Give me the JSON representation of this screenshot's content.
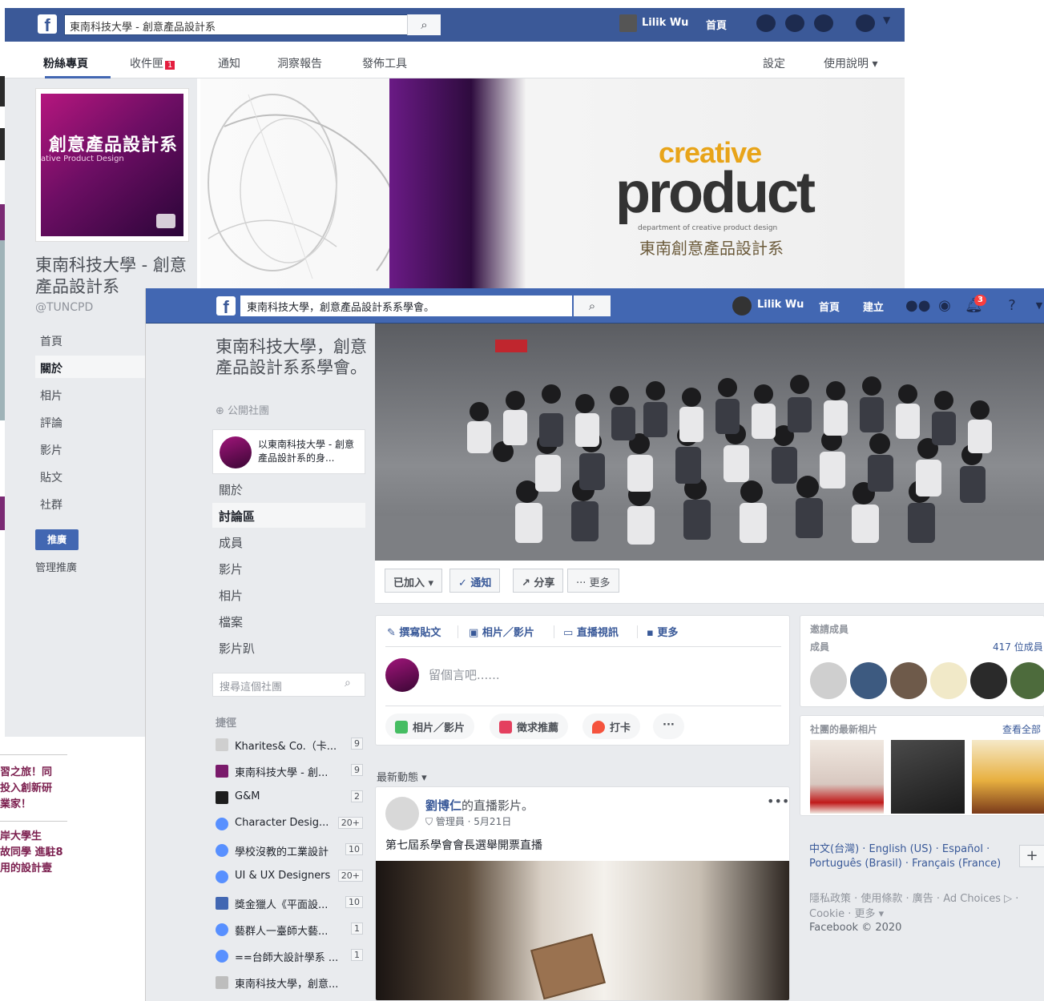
{
  "colors": {
    "fb_blue": "#4267b2",
    "fb_blue_dark": "#3b5998",
    "link": "#385898",
    "badge_red": "#fa3e3e",
    "page_purple": "#6d0e64"
  },
  "background_window": {
    "search_value": "東南科技大學 - 創意產品設計系",
    "user_name": "Lilik Wu",
    "home_label": "首頁",
    "tabs": [
      {
        "label": "粉絲專頁",
        "active": true
      },
      {
        "label": "收件匣",
        "badge": "1"
      },
      {
        "label": "通知"
      },
      {
        "label": "洞察報告"
      },
      {
        "label": "發佈工具"
      }
    ],
    "settings_label": "設定",
    "help_label": "使用說明 ▾",
    "page_pic_title": "創意產品設計系",
    "page_pic_subtitle": "ative Product Design",
    "page_name": "東南科技大學 - 創意產品設計系",
    "page_handle": "@TUNCPD",
    "nav": [
      {
        "label": "首頁"
      },
      {
        "label": "關於",
        "active": true
      },
      {
        "label": "相片"
      },
      {
        "label": "評論"
      },
      {
        "label": "影片"
      },
      {
        "label": "貼文"
      },
      {
        "label": "社群"
      }
    ],
    "promote_label": "推廣",
    "manage_promotions_label": "管理推廣",
    "cover_creative": "creative",
    "cover_product": "product",
    "cover_department": "department of creative product design",
    "cover_chinese": "東南創意產品設計系",
    "left_notes": [
      "習之旅！同\n投入創新研\n業家！",
      "岸大學生\n故同學 進駐8\n用的設計壹"
    ]
  },
  "foreground_window": {
    "search_value": "東南科技大學，創意產品設計系系學會。",
    "user_name": "Lilik Wu",
    "top_nav": [
      "首頁",
      "建立"
    ],
    "notification_count": "3",
    "group_name": "東南科技大學，創意產品設計系系學會。",
    "group_type": "公開社團",
    "shortcut_box_text": "以東南科技大學 - 創意產品設計系的身...",
    "left_nav": [
      {
        "label": "關於"
      },
      {
        "label": "討論區",
        "active": true
      },
      {
        "label": "成員"
      },
      {
        "label": "影片"
      },
      {
        "label": "相片"
      },
      {
        "label": "檔案"
      },
      {
        "label": "影片趴"
      }
    ],
    "group_search_placeholder": "搜尋這個社團",
    "shortcuts_heading": "捷徑",
    "shortcuts": [
      {
        "name": "Kharites& Co.（卡...",
        "count": "9",
        "icon_color": "#cfcfcf"
      },
      {
        "name": "東南科技大學 - 創...",
        "count": "9",
        "icon_color": "#7a1a6b"
      },
      {
        "name": "G&M",
        "count": "2",
        "icon_color": "#1d1d1d"
      },
      {
        "name": "Character Desig...",
        "count": "20+",
        "icon_color": "#5890ff"
      },
      {
        "name": "學校沒教的工業設計",
        "count": "10",
        "icon_color": "#5890ff"
      },
      {
        "name": "UI & UX Designers",
        "count": "20+",
        "icon_color": "#5890ff"
      },
      {
        "name": "獎金獵人《平面設...",
        "count": "10",
        "icon_color": "#4267b2"
      },
      {
        "name": "藝群人一臺師大藝...",
        "count": "1",
        "icon_color": "#5890ff"
      },
      {
        "name": "==台師大設計學系 ...",
        "count": "1",
        "icon_color": "#5890ff"
      },
      {
        "name": "東南科技大學，創意...",
        "count": "",
        "icon_color": "#bdbdbd"
      }
    ],
    "actions": {
      "joined": "已加入 ▾",
      "notify": "✓ 通知",
      "share": "↗ 分享",
      "more": "··· 更多"
    },
    "composer": {
      "tabs": [
        "撰寫貼文",
        "相片／影片",
        "直播視訊",
        "更多"
      ],
      "placeholder": "留個言吧......",
      "buttons": [
        "相片／影片",
        "徵求推薦",
        "打卡",
        "···"
      ]
    },
    "feed_heading": "最新動態 ▾",
    "post": {
      "author": "劉博仁",
      "action": "的直播影片。",
      "role": "管理員",
      "date": "5月21日",
      "text": "第七屆系學會會長選舉開票直播"
    },
    "invite_members_label": "邀請成員",
    "members_label": "成員",
    "members_count": "417 位成員",
    "recent_photos_label": "社團的最新相片",
    "see_all_label": "查看全部",
    "languages": "中文(台灣) · English (US) · Español · Português (Brasil) · Français (France)",
    "footer_links": "隱私政策 · 使用條款 · 廣告 · Ad Choices ▷ · Cookie · 更多 ▾",
    "copyright": "Facebook © 2020"
  }
}
